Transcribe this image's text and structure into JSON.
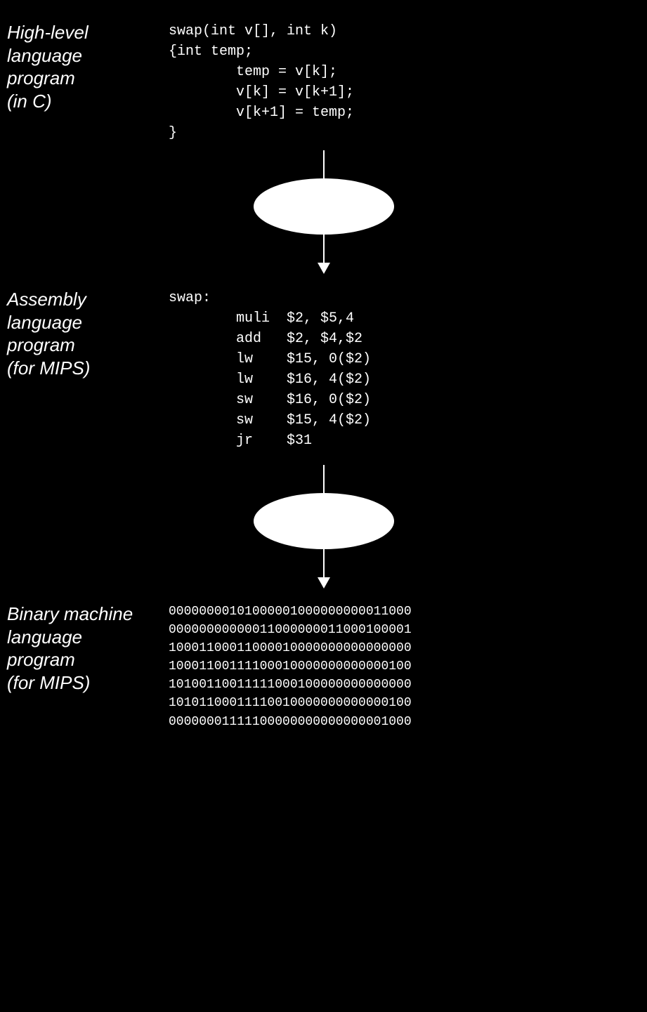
{
  "sections": {
    "highlevel": {
      "label": "High-level\nlanguage\nprogram\n(in C)",
      "code": "swap(int v[], int k)\n{int temp;\n        temp = v[k];\n        v[k] = v[k+1];\n        v[k+1] = temp;\n}"
    },
    "assembly": {
      "label": "Assembly\nlanguage\nprogram\n(for MIPS)",
      "code": "swap:\n        muli  $2, $5,4\n        add   $2, $4,$2\n        lw    $15, 0($2)\n        lw    $16, 4($2)\n        sw    $16, 0($2)\n        sw    $15, 4($2)\n        jr    $31"
    },
    "binary": {
      "label": "Binary machine\nlanguage\nprogram\n(for MIPS)",
      "code": "00000000101000001000000000011000\n00000000000011000000011000100001\n10001100011000010000000000000000\n10001100111100010000000000000100\n10100110011111000100000000000000\n10101100011110010000000000000100\n00000001111100000000000000001000"
    }
  },
  "connectors": {
    "arrow_line_height_1": 40,
    "ellipse_width": 200,
    "ellipse_height": 80,
    "arrow_line_height_2": 40
  }
}
